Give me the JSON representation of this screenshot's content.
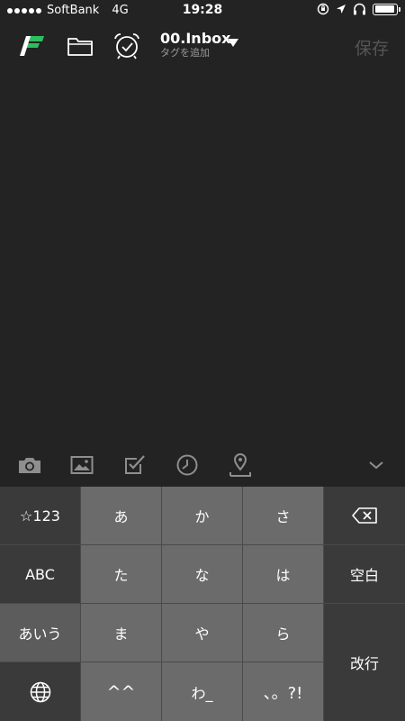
{
  "status_bar": {
    "carrier": "SoftBank",
    "network": "4G",
    "time": "19:28",
    "battery_level": 0.95
  },
  "toolbar": {
    "notebook_name": "00.Inbox",
    "tag_placeholder": "タグを追加",
    "save_label": "保存"
  },
  "insert_bar": {
    "icons": [
      "camera-icon",
      "image-icon",
      "checkbox-icon",
      "clock-icon",
      "location-pin-icon",
      "chevron-down-icon"
    ]
  },
  "keyboard": {
    "left_keys": [
      "☆123",
      "ABC",
      "あいう"
    ],
    "row1": [
      "あ",
      "か",
      "さ"
    ],
    "row2": [
      "た",
      "な",
      "は"
    ],
    "row3": [
      "ま",
      "や",
      "ら"
    ],
    "row4": [
      "^^",
      "わ_",
      "、。?!"
    ],
    "space_label": "空白",
    "return_label": "改行"
  },
  "colors": {
    "background": "#232323",
    "brand_green": "#2dbe60",
    "key_dark": "#3a3a3a",
    "key_light": "#6b6b6b"
  }
}
